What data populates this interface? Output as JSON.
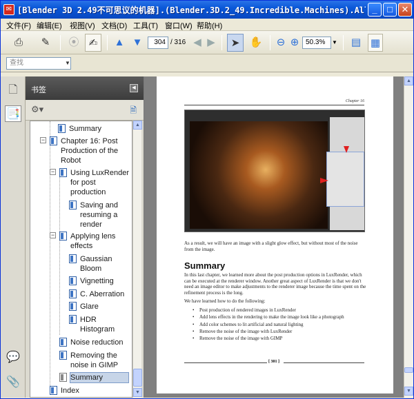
{
  "window": {
    "title": "[Blender 3D 2.49不可思议的机器].(Blender.3D.2_49.Incredible.Machines).All...",
    "app_icon_glyph": "✉",
    "min": "_",
    "max": "□",
    "close": "✕"
  },
  "menu": [
    "文件(F)",
    "编辑(E)",
    "视图(V)",
    "文档(D)",
    "工具(T)",
    "窗口(W)",
    "帮助(H)"
  ],
  "toolbar": {
    "page_current": "304",
    "page_total": "/ 316",
    "zoom": "50.3%"
  },
  "search": {
    "placeholder": "查找"
  },
  "panel": {
    "title": "书签",
    "bookmarks": [
      {
        "label": "Summary"
      },
      {
        "label": "Chapter 16: Post Production of the Robot"
      },
      {
        "label": "Using LuxRender for post production"
      },
      {
        "label": "Saving and resuming a render"
      },
      {
        "label": "Applying lens effects"
      },
      {
        "label": "Gaussian Bloom"
      },
      {
        "label": "Vignetting"
      },
      {
        "label": "C. Aberration"
      },
      {
        "label": "Glare"
      },
      {
        "label": "HDR Histogram"
      },
      {
        "label": "Noise reduction"
      },
      {
        "label": "Removing the noise in GIMP"
      },
      {
        "label": "Summary"
      },
      {
        "label": "Index"
      }
    ]
  },
  "page": {
    "running_header": "Chapter 16",
    "caption": "As a result, we will have an image with a slight glow effect, but without most of the noise from the image.",
    "heading": "Summary",
    "para1": "In this last chapter, we learned more about the post production options in LuxRender, which can be executed at the renderer window. Another great aspect of LuxRender is that we don't need an image editor to make adjustments to the renderer image because the time spent on the refinement process is the long.",
    "para2": "We have learned how to do the following:",
    "bullets": [
      "Post production of rendered images in LuxRender",
      "Add lens effects in the rendering to make the image look like a photograph",
      "Add color schemes to lit artificial and natural lighting",
      "Remove the noise of the image with LuxRender",
      "Remove the noise of the image with GIMP"
    ],
    "page_number": "[ 301 ]"
  }
}
